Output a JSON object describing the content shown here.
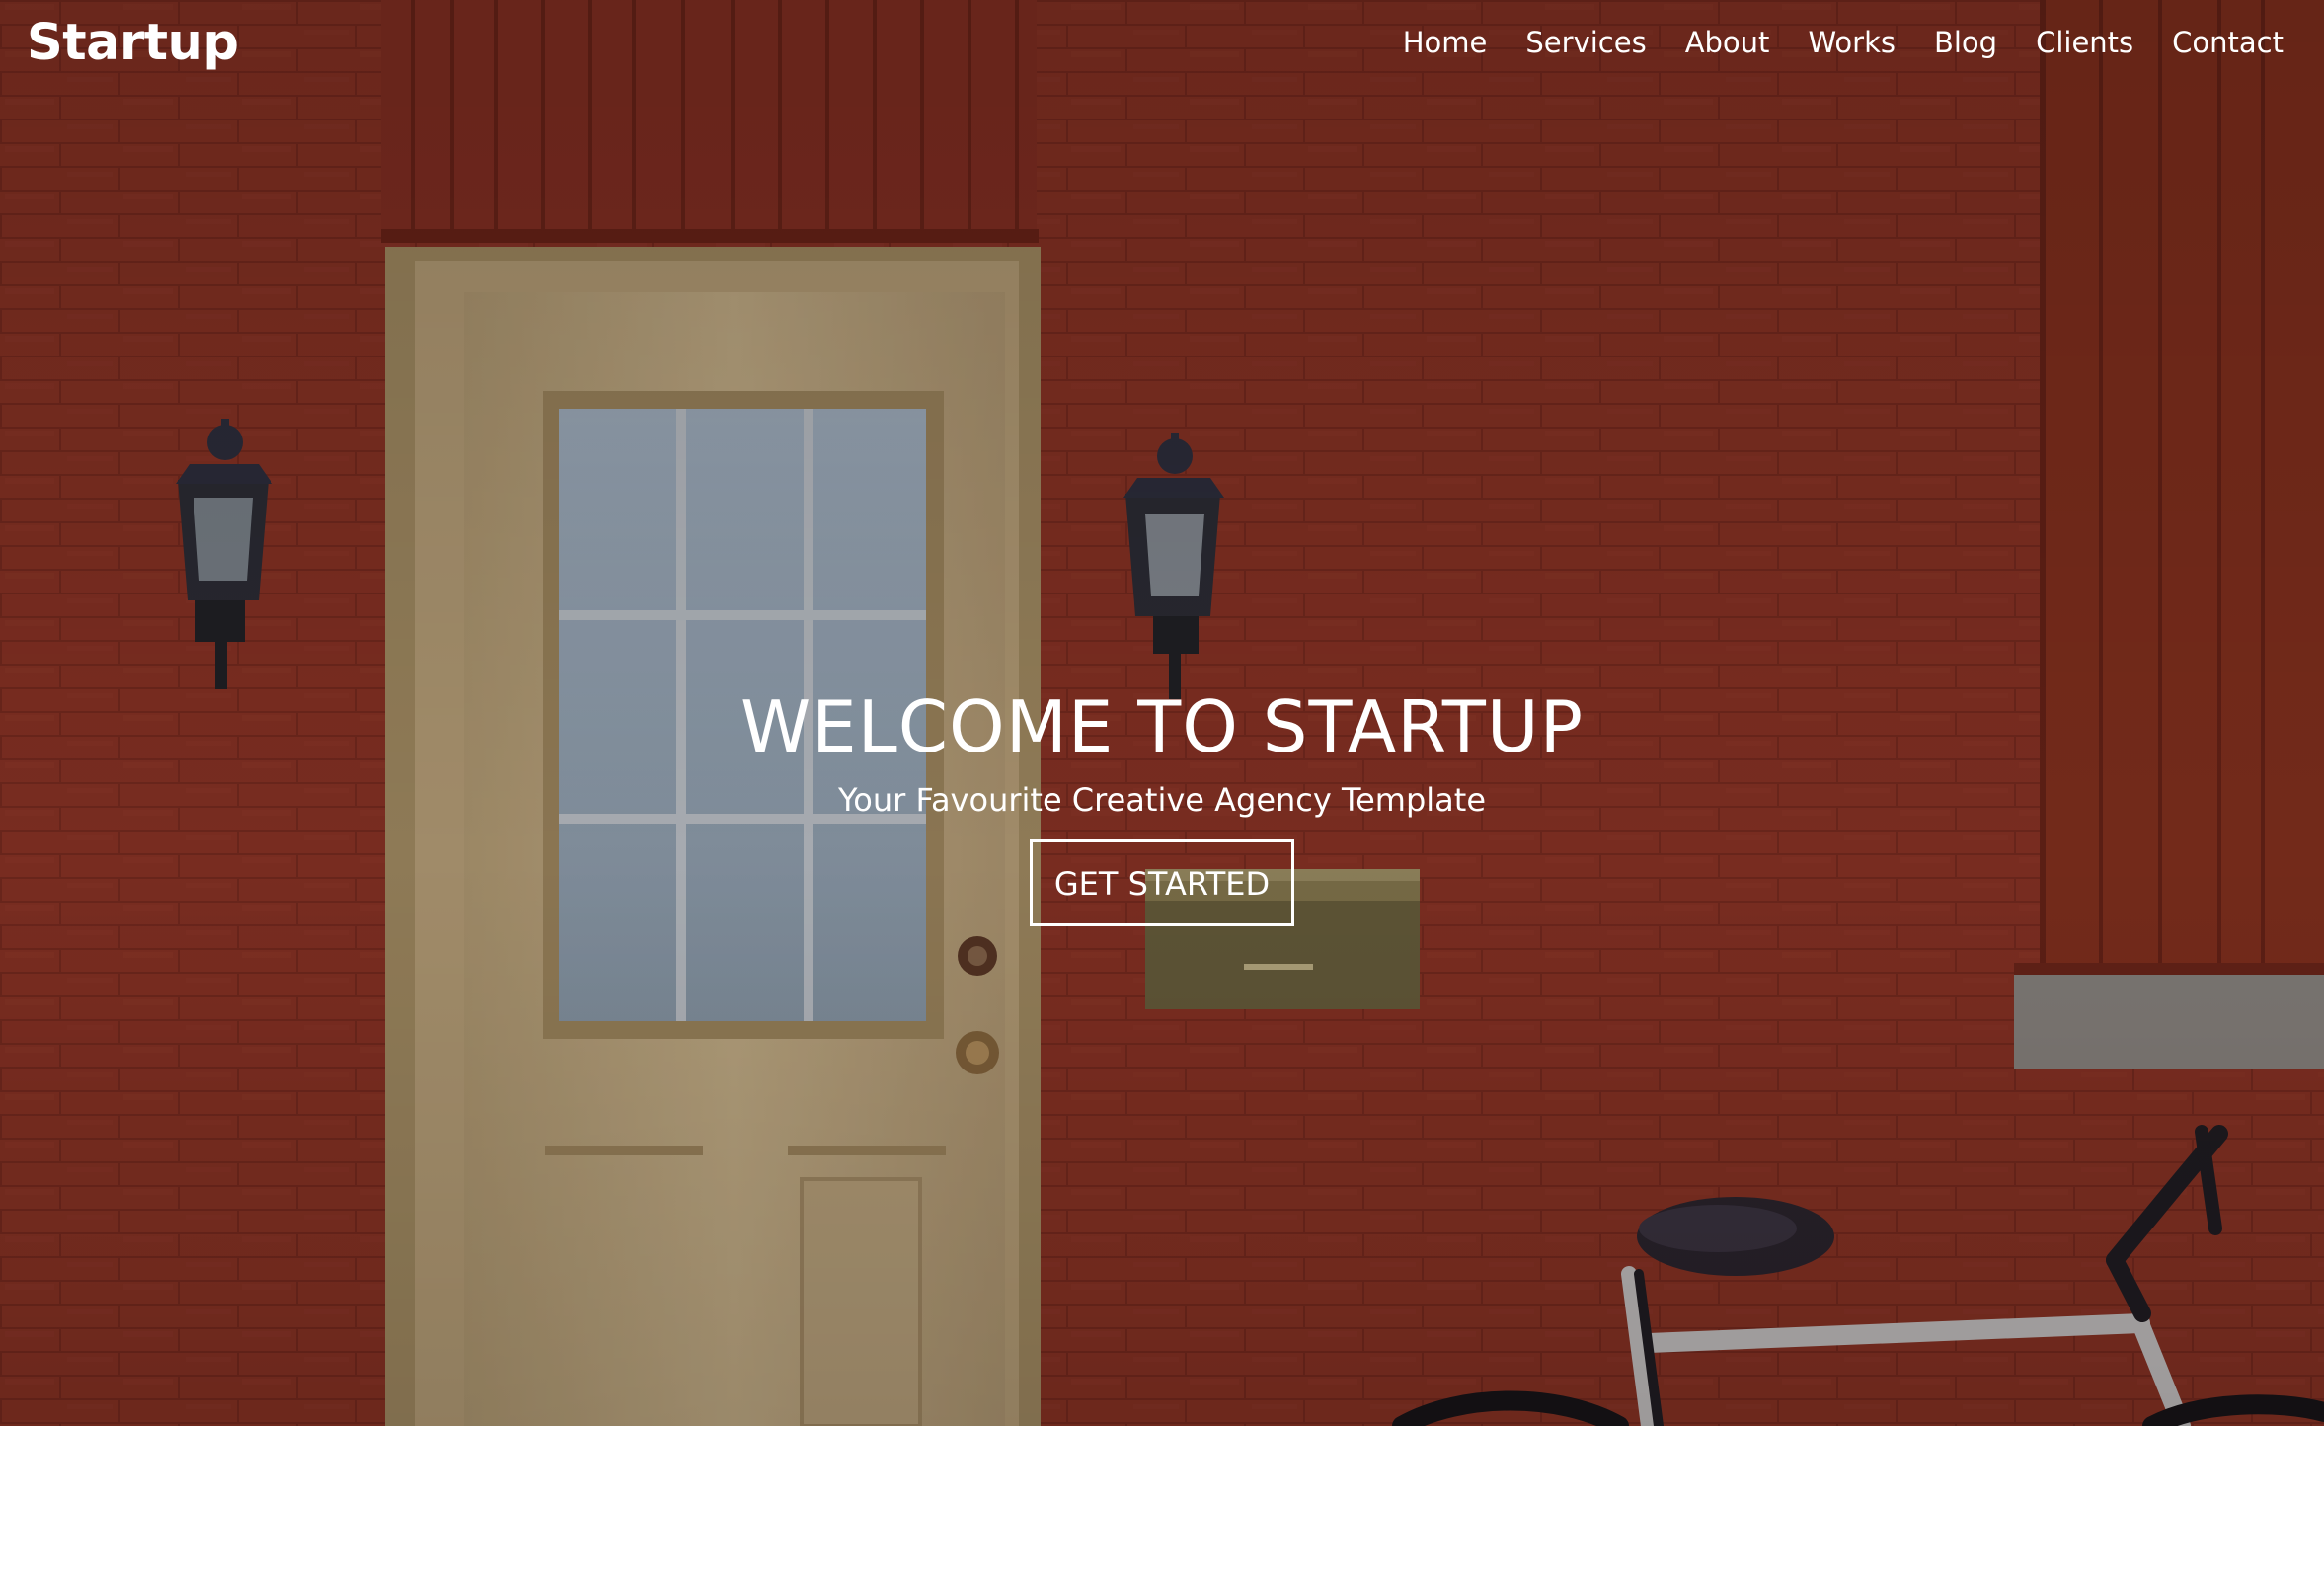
{
  "brand": {
    "name": "Startup"
  },
  "nav": {
    "items": [
      {
        "label": "Home"
      },
      {
        "label": "Services"
      },
      {
        "label": "About"
      },
      {
        "label": "Works"
      },
      {
        "label": "Blog"
      },
      {
        "label": "Clients"
      },
      {
        "label": "Contact"
      }
    ]
  },
  "hero": {
    "title": "WELCOME TO STARTUP",
    "subtitle": "Your Favourite Creative Agency Template",
    "cta_label": "GET STARTED"
  },
  "colors": {
    "brick": "#8e3526",
    "door": "#c9b48a",
    "text": "#ffffff"
  },
  "icons": [
    "wall-lamp-icon",
    "mailbox-icon",
    "bicycle-icon"
  ]
}
